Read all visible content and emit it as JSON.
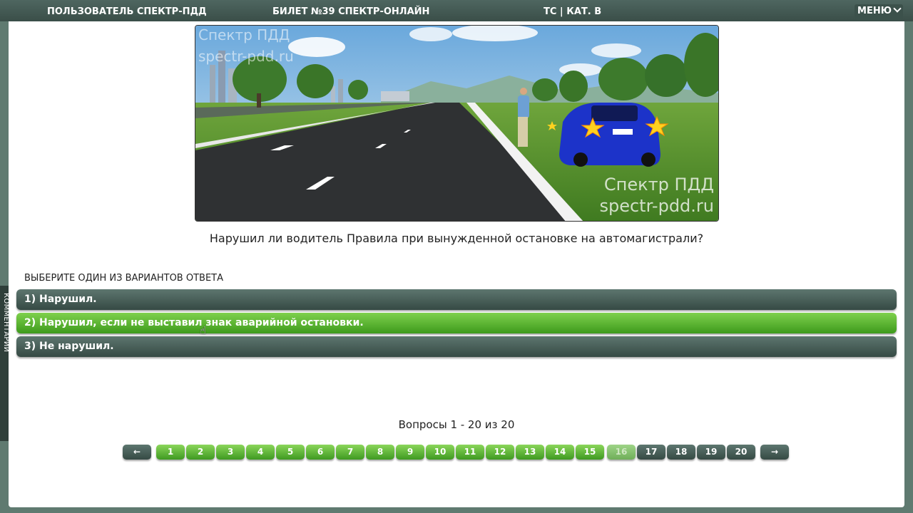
{
  "header": {
    "user": "ПОЛЬЗОВАТЕЛЬ СПЕКТР-ПДД",
    "ticket": "БИЛЕТ №39 СПЕКТР-ОНЛАЙН",
    "category": "ТС | КАТ. В",
    "menu_label": "МЕНЮ"
  },
  "image": {
    "watermark_top1": "Спектр ПДД",
    "watermark_top2": "spectr-pdd.ru",
    "watermark_bottom1": "Спектр ПДД",
    "watermark_bottom2": "spectr-pdd.ru"
  },
  "question": "Нарушил ли водитель Правила при вынужденной остановке на автомагистрали?",
  "answers_label": "ВЫБЕРИТЕ ОДИН ИЗ ВАРИАНТОВ ОТВЕТА",
  "answers": [
    {
      "label": "1) Нарушил.",
      "selected": false
    },
    {
      "label": "2) Нарушил, если не выставил знак аварийной остановки.",
      "selected": true
    },
    {
      "label": "3) Не нарушил.",
      "selected": false
    }
  ],
  "pager": {
    "summary": "Вопросы 1 - 20 из 20",
    "prev": "←",
    "next": "→",
    "current": "16",
    "pages": [
      "1",
      "2",
      "3",
      "4",
      "5",
      "6",
      "7",
      "8",
      "9",
      "10",
      "11",
      "12",
      "13",
      "14",
      "15",
      "16",
      "17",
      "18",
      "19",
      "20"
    ]
  },
  "side_tab": "КОММЕНТАРИЙ",
  "colors": {
    "header_bg": "#4e6660",
    "answer_dark": "#364a44",
    "answer_selected": "#3d9a1c",
    "page_green": "#3f9a21"
  }
}
